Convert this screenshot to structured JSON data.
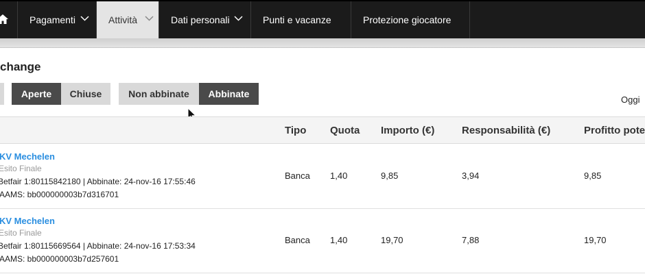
{
  "nav": {
    "home_icon": "home-icon",
    "items": [
      {
        "label": "Pagamenti",
        "has_dropdown": true
      },
      {
        "label": "Attività",
        "has_dropdown": true,
        "active": true
      },
      {
        "label": "Dati personali",
        "has_dropdown": true
      },
      {
        "label": "Punti e vacanze",
        "has_dropdown": false
      },
      {
        "label": "Protezione giocatore",
        "has_dropdown": false
      }
    ]
  },
  "page": {
    "title": "change",
    "date_label": "Oggi"
  },
  "filters": {
    "status": {
      "open": "Aperte",
      "closed": "Chiuse",
      "selected": "Aperte"
    },
    "match": {
      "unmatched": "Non abbinate",
      "matched": "Abbinate",
      "selected": "Abbinate"
    }
  },
  "table": {
    "headers": {
      "tipo": "Tipo",
      "quota": "Quota",
      "importo": "Importo (€)",
      "responsabilita": "Responsabilità (€)",
      "profitto": "Profitto pote"
    },
    "rows": [
      {
        "event": "KV Mechelen",
        "market": "Esito Finale",
        "ref": "Betfair 1:80115842180 | Abbinate: 24-nov-16 17:55:46",
        "aams": "AAMS: bb000000003b7d316701",
        "tipo": "Banca",
        "quota": "1,40",
        "importo": "9,85",
        "responsabilita": "3,94",
        "profitto": "9,85"
      },
      {
        "event": "KV Mechelen",
        "market": "Esito Finale",
        "ref": "Betfair 1:80115669564 | Abbinate: 24-nov-16 17:53:34",
        "aams": "AAMS: bb000000003b7d257601",
        "tipo": "Banca",
        "quota": "1,40",
        "importo": "19,70",
        "responsabilita": "7,88",
        "profitto": "19,70"
      }
    ]
  },
  "colors": {
    "nav_bg": "#1b1b1b",
    "nav_active_bg": "#e4e4e4",
    "button_dark": "#4a4a4a",
    "button_light": "#d9d9d9",
    "event_link": "#2a8ee0"
  }
}
